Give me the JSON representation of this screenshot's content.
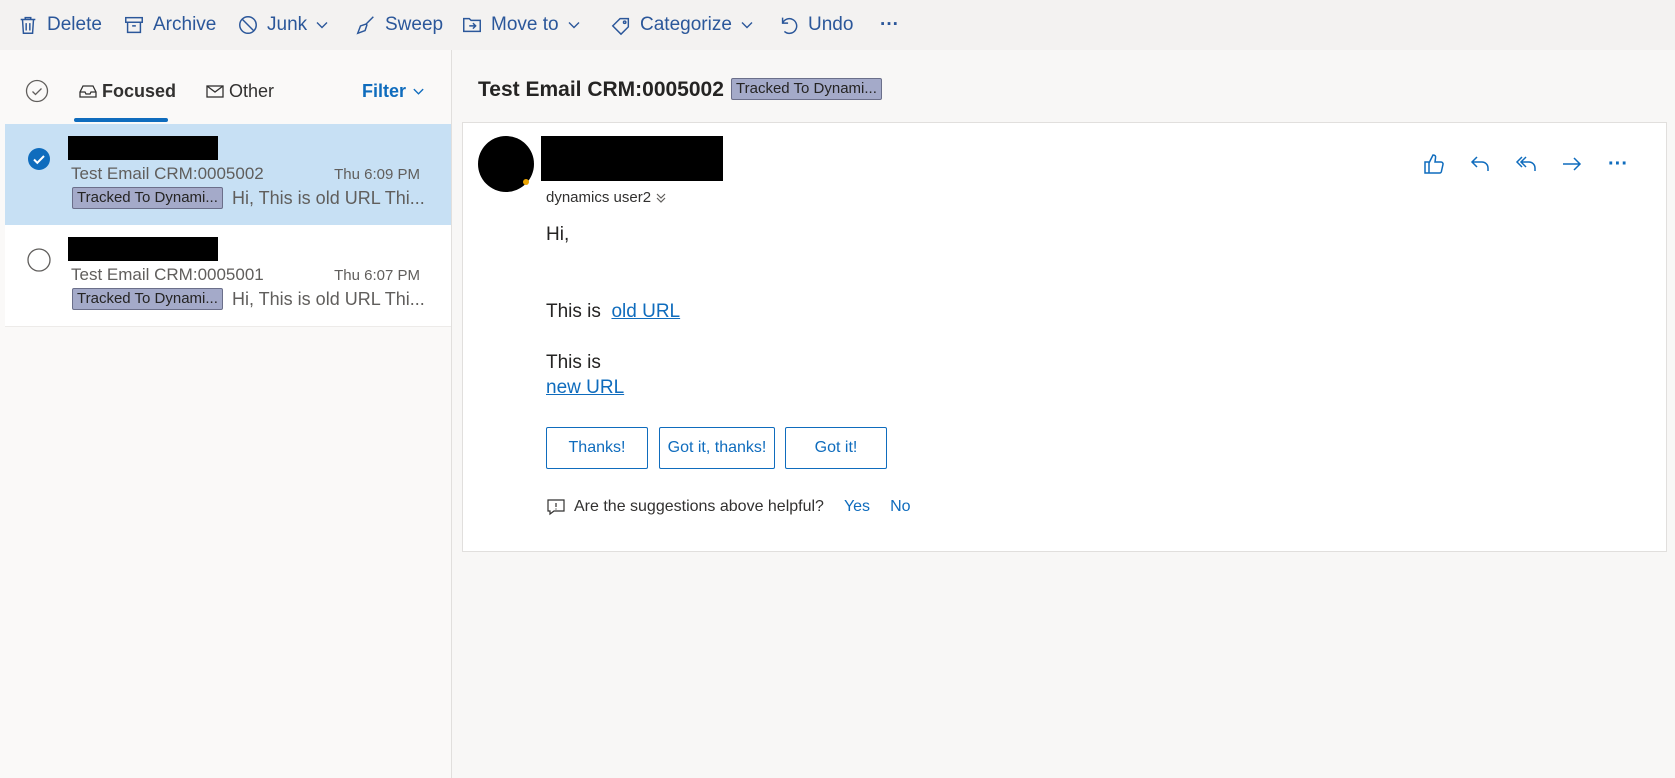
{
  "toolbar": {
    "delete": "Delete",
    "archive": "Archive",
    "junk": "Junk",
    "sweep": "Sweep",
    "move_to": "Move to",
    "categorize": "Categorize",
    "undo": "Undo",
    "more": "···"
  },
  "list": {
    "tabs": {
      "focused": "Focused",
      "other": "Other"
    },
    "filter": "Filter",
    "messages": [
      {
        "subject": "Test Email CRM:0005002",
        "time": "Thu 6:09 PM",
        "tag": "Tracked To Dynami...",
        "preview": "Hi, This is old URL Thi...",
        "selected": true
      },
      {
        "subject": "Test Email CRM:0005001",
        "time": "Thu 6:07 PM",
        "tag": "Tracked To Dynami...",
        "preview": "Hi, This is old URL Thi...",
        "selected": false
      }
    ]
  },
  "reading": {
    "subject": "Test Email CRM:0005002",
    "tag": "Tracked To Dynami...",
    "recipient": "dynamics user2",
    "more": "···",
    "body": {
      "greeting": "Hi,",
      "line1_prefix": "This is",
      "line1_link": "old URL",
      "line2_prefix": "This is",
      "line2_link": "new URL"
    },
    "quick_replies": [
      "Thanks!",
      "Got it, thanks!",
      "Got it!"
    ],
    "feedback": {
      "question": "Are the suggestions above helpful?",
      "yes": "Yes",
      "no": "No"
    }
  },
  "colors": {
    "accent": "#0f6cbd",
    "toolbar_text": "#2b579a",
    "selected_row": "#c7e0f4",
    "tag_bg": "#a4aac9"
  }
}
